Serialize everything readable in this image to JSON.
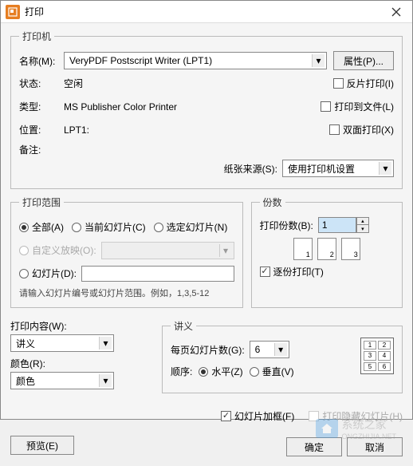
{
  "titlebar": {
    "title": "打印"
  },
  "printer": {
    "legend": "打印机",
    "name_label": "名称(M):",
    "name_value": "VeryPDF Postscript Writer (LPT1)",
    "props_btn": "属性(P)...",
    "status_label": "状态:",
    "status_value": "空闲",
    "type_label": "类型:",
    "type_value": "MS Publisher Color Printer",
    "where_label": "位置:",
    "where_value": "LPT1:",
    "comment_label": "备注:",
    "invert_label": "反片打印(I)",
    "tofile_label": "打印到文件(L)",
    "duplex_label": "双面打印(X)",
    "source_label": "纸张来源(S):",
    "source_value": "使用打印机设置"
  },
  "range": {
    "legend": "打印范围",
    "all": "全部(A)",
    "current": "当前幻灯片(C)",
    "selected": "选定幻灯片(N)",
    "custom_show": "自定义放映(O):",
    "slides": "幻灯片(D):",
    "hint": "请输入幻灯片编号或幻灯片范围。例如，1,3,5-12"
  },
  "copies": {
    "legend": "份数",
    "count_label": "打印份数(B):",
    "count_value": "1",
    "collate": "逐份打印(T)",
    "icon1": "1",
    "icon2": "2",
    "icon3": "3"
  },
  "content": {
    "label": "打印内容(W):",
    "value": "讲义",
    "color_label": "颜色(R):",
    "color_value": "颜色"
  },
  "handouts": {
    "legend": "讲义",
    "per_page_label": "每页幻灯片数(G):",
    "per_page_value": "6",
    "order_label": "顺序:",
    "horiz": "水平(Z)",
    "vert": "垂直(V)",
    "cells": [
      "1",
      "2",
      "3",
      "4",
      "5",
      "6"
    ]
  },
  "options": {
    "frame": "幻灯片加框(F)",
    "hidden": "打印隐藏幻灯片(H)"
  },
  "footer": {
    "preview": "预览(E)",
    "ok": "确定",
    "cancel": "取消"
  },
  "watermark": {
    "text": "系统之家",
    "url": "ONGZHIJIA.NET"
  }
}
